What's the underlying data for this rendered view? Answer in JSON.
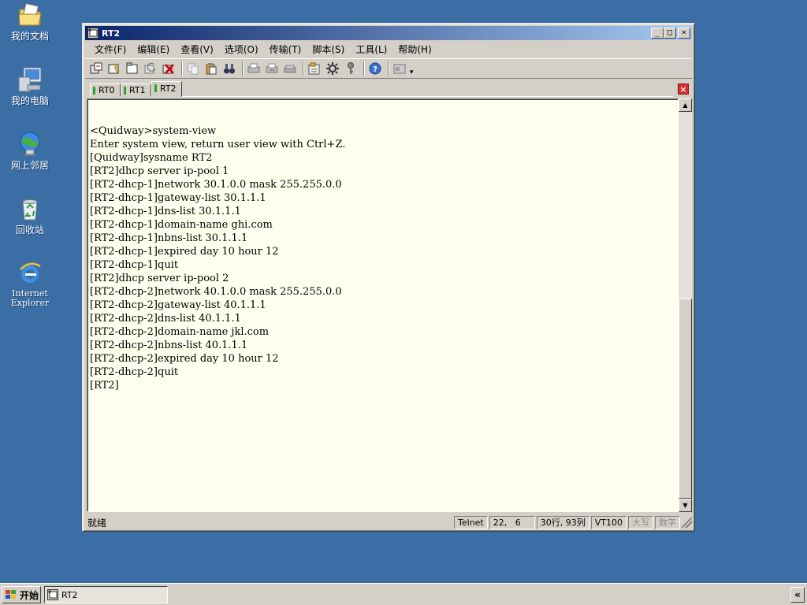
{
  "desktop": {
    "icons": [
      {
        "label": "我的文档",
        "icon": "my-documents-icon"
      },
      {
        "label": "我的电脑",
        "icon": "my-computer-icon"
      },
      {
        "label": "网上邻居",
        "icon": "network-places-icon"
      },
      {
        "label": "回收站",
        "icon": "recycle-bin-icon"
      },
      {
        "label": "Internet Explorer",
        "icon": "internet-explorer-icon"
      }
    ]
  },
  "window": {
    "title": "RT2",
    "controls": {
      "minimize": "_",
      "maximize": "□",
      "close": "×"
    }
  },
  "menubar": {
    "items": [
      "文件(F)",
      "编辑(E)",
      "查看(V)",
      "选项(O)",
      "传输(T)",
      "脚本(S)",
      "工具(L)",
      "帮助(H)"
    ]
  },
  "toolbar": {
    "more_glyph": "▾"
  },
  "tabs": [
    {
      "label": "RT0",
      "active": false
    },
    {
      "label": "RT1",
      "active": false
    },
    {
      "label": "RT2",
      "active": true
    }
  ],
  "tab_close": "×",
  "terminal": {
    "lines": [
      "<Quidway>system-view",
      "Enter system view, return user view with Ctrl+Z.",
      "[Quidway]sysname RT2",
      "[RT2]dhcp server ip-pool 1",
      "[RT2-dhcp-1]network 30.1.0.0 mask 255.255.0.0",
      "[RT2-dhcp-1]gateway-list 30.1.1.1",
      "[RT2-dhcp-1]dns-list 30.1.1.1",
      "[RT2-dhcp-1]domain-name ghi.com",
      "[RT2-dhcp-1]nbns-list 30.1.1.1",
      "[RT2-dhcp-1]expired day 10 hour 12",
      "[RT2-dhcp-1]quit",
      "[RT2]dhcp server ip-pool 2",
      "[RT2-dhcp-2]network 40.1.0.0 mask 255.255.0.0",
      "[RT2-dhcp-2]gateway-list 40.1.1.1",
      "[RT2-dhcp-2]dns-list 40.1.1.1",
      "[RT2-dhcp-2]domain-name jkl.com",
      "[RT2-dhcp-2]nbns-list 40.1.1.1",
      "[RT2-dhcp-2]expired day 10 hour 12",
      "[RT2-dhcp-2]quit",
      "[RT2]"
    ]
  },
  "scrollbar": {
    "up": "▲",
    "down": "▼"
  },
  "statusbar": {
    "status": "就绪",
    "protocol": "Telnet",
    "cursor": "22,   6",
    "size": "30行, 93列",
    "emulation": "VT100",
    "caps": "大写",
    "num": "数字"
  },
  "taskbar": {
    "start_label": "开始",
    "task_label": "RT2",
    "tray_chevron": "«"
  }
}
